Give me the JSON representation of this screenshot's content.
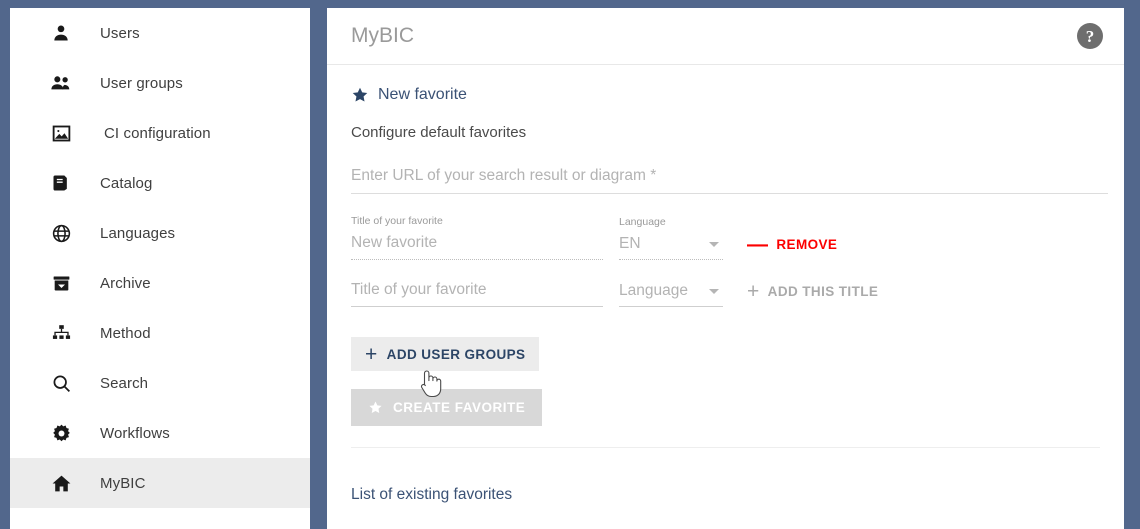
{
  "sidebar": {
    "items": [
      {
        "label": "Users",
        "icon": "person-icon",
        "active": false
      },
      {
        "label": "User groups",
        "icon": "people-icon",
        "active": false
      },
      {
        "label": "CI configuration",
        "icon": "image-icon",
        "active": false
      },
      {
        "label": "Catalog",
        "icon": "book-icon",
        "active": false
      },
      {
        "label": "Languages",
        "icon": "globe-icon",
        "active": false
      },
      {
        "label": "Archive",
        "icon": "archive-icon",
        "active": false
      },
      {
        "label": "Method",
        "icon": "sitemap-icon",
        "active": false
      },
      {
        "label": "Search",
        "icon": "search-icon",
        "active": false
      },
      {
        "label": "Workflows",
        "icon": "gear-icon",
        "active": false
      },
      {
        "label": "MyBIC",
        "icon": "home-icon",
        "active": true
      }
    ]
  },
  "header": {
    "title": "MyBIC",
    "help_icon": "help-circle-icon"
  },
  "main": {
    "new_favorite_link": "New favorite",
    "new_favorite_icon": "star-icon",
    "configure_text": "Configure default favorites",
    "url_field": {
      "placeholder": "Enter URL of your search result or diagram *",
      "value": ""
    },
    "title_rows": [
      {
        "label": "Title of your favorite",
        "value": "New favorite",
        "placeholder": "New favorite",
        "language_label": "Language",
        "language_value": "EN",
        "action_label": "REMOVE",
        "action_sign": "—",
        "action_color": "#fc0000"
      },
      {
        "label": "",
        "value": "",
        "placeholder": "Title of your favorite",
        "language_label": "",
        "language_value": "Language",
        "action_label": "ADD THIS TITLE",
        "action_sign": "+",
        "action_color": "#aaaaaa"
      }
    ],
    "add_user_groups_label": "ADD USER GROUPS",
    "add_user_groups_sign": "+",
    "create_favorite_label": "CREATE FAVORITE",
    "create_favorite_icon": "star-icon",
    "existing_favorites_title": "List of existing favorites"
  },
  "colors": {
    "app_background": "#52678c",
    "panel_background": "#ffffff",
    "accent_navy": "#2c4566",
    "link_blue": "#3b5275",
    "danger_red": "#fc0000",
    "disabled_gray": "#d8d8d8",
    "active_row": "#ececec"
  }
}
